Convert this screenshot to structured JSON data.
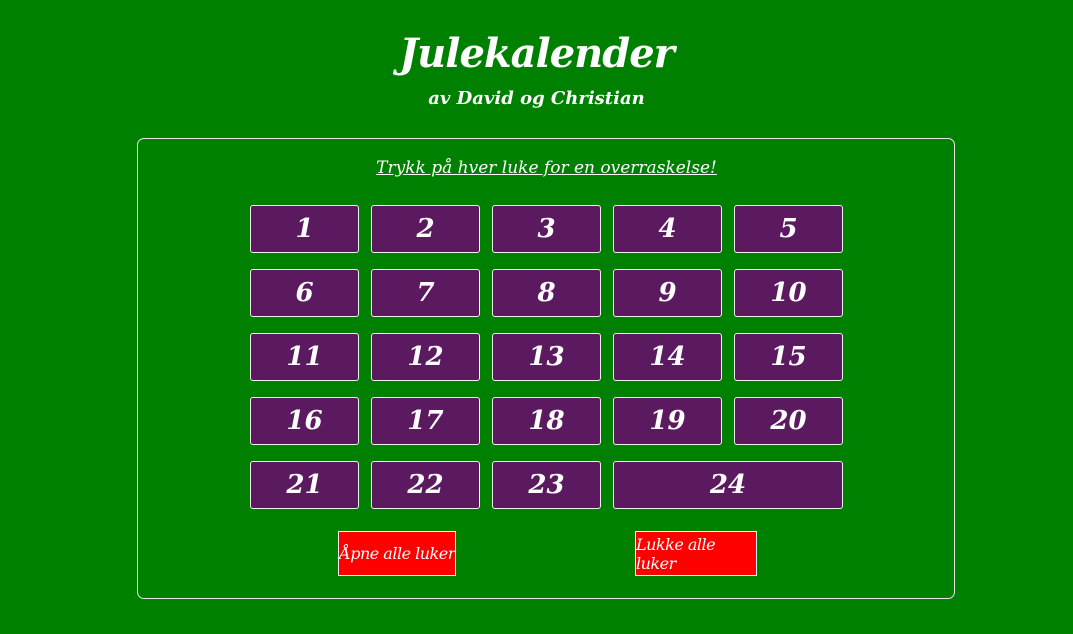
{
  "header": {
    "title": "Julekalender",
    "subtitle": "av David og Christian"
  },
  "calendar": {
    "instruction": "Trykk på hver luke for en overraskelse!",
    "hatches": [
      "1",
      "2",
      "3",
      "4",
      "5",
      "6",
      "7",
      "8",
      "9",
      "10",
      "11",
      "12",
      "13",
      "14",
      "15",
      "16",
      "17",
      "18",
      "19",
      "20",
      "21",
      "22",
      "23",
      "24"
    ]
  },
  "actions": {
    "open_all": "Åpne alle luker",
    "close_all": "Lukke alle luker"
  },
  "colors": {
    "background": "#008000",
    "hatch": "#5b1a60",
    "action_button": "#ff0000",
    "text": "#ffffff"
  }
}
